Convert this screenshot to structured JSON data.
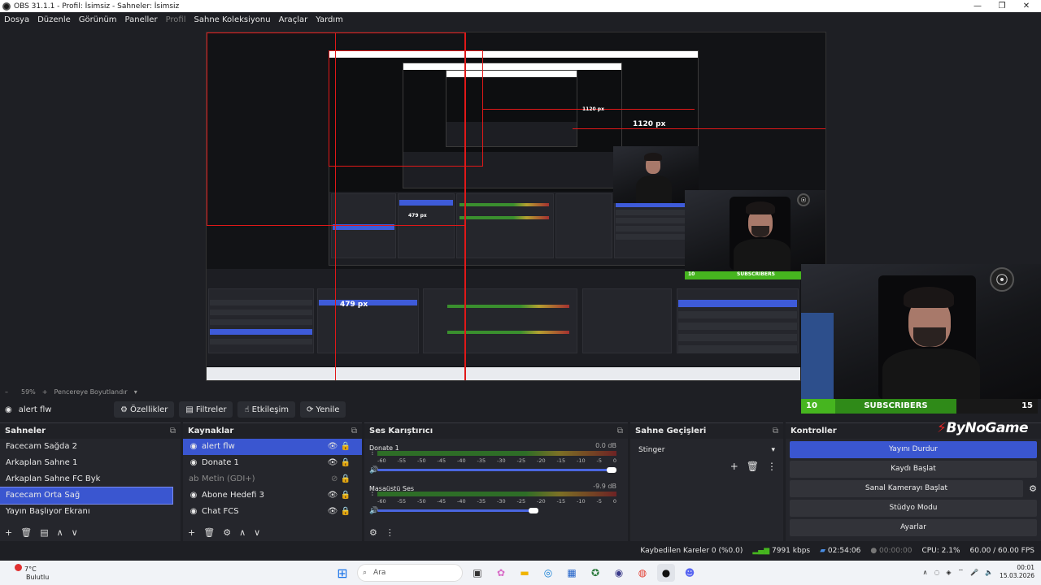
{
  "window": {
    "title": "OBS 31.1.1 - Profil: İsimsiz - Sahneler: İsimsiz",
    "controls": [
      "—",
      "❐",
      "✕"
    ]
  },
  "menu": [
    "Dosya",
    "Düzenle",
    "Görünüm",
    "Paneller",
    "Profil",
    "Sahne Koleksiyonu",
    "Araçlar",
    "Yardım"
  ],
  "preview": {
    "zoom": "59%",
    "zoom_label": "Pencereye Boyutlandır",
    "width_label": "1120 px",
    "height_label": "479 px",
    "nested_width_label": "1120 px",
    "nested_height_label": "479 px"
  },
  "subscribers": {
    "left": "10",
    "label": "SUBSCRIBERS",
    "right": "15"
  },
  "source_toolbar": {
    "selected_source": "alert flw",
    "properties": "Özellikler",
    "filters": "Filtreler",
    "interact": "Etkileşim",
    "refresh": "Yenile"
  },
  "scenes": {
    "title": "Sahneler",
    "items": [
      "Facecam Sağda 2",
      "Arkaplan Sahne 1",
      "Arkaplan Sahne FC Byk",
      "Facecam Orta Sağ",
      "Yayın Başlıyor Ekranı"
    ],
    "selected_index": 3
  },
  "sources": {
    "title": "Kaynaklar",
    "items": [
      {
        "name": "alert flw",
        "icon": "globe-icon"
      },
      {
        "name": "Donate 1",
        "icon": "globe-icon"
      },
      {
        "name": "Metin (GDI+)",
        "icon": "text-icon"
      },
      {
        "name": "Abone Hedefi 3",
        "icon": "globe-icon"
      },
      {
        "name": "Chat FCS",
        "icon": "globe-icon"
      }
    ]
  },
  "mixer": {
    "title": "Ses Karıştırıcı",
    "channels": [
      {
        "name": "Donate 1",
        "db": "0.0 dB",
        "volume": 1.0
      },
      {
        "name": "Masaüstü Ses",
        "db": "-9.9 dB",
        "volume": 0.65
      }
    ],
    "ticks": [
      "-60",
      "-55",
      "-50",
      "-45",
      "-40",
      "-35",
      "-30",
      "-25",
      "-20",
      "-15",
      "-10",
      "-5",
      "0"
    ]
  },
  "transitions": {
    "title": "Sahne Geçişleri",
    "selected": "Stinger"
  },
  "controls": {
    "title": "Kontroller",
    "buttons": [
      "Yayını Durdur",
      "Kaydı Başlat",
      "Sanal Kamerayı Başlat",
      "Stüdyo Modu",
      "Ayarlar"
    ]
  },
  "logo": {
    "text": "ByNoGame"
  },
  "status": {
    "dropped": "Kaybedilen Kareler 0 (%0.0)",
    "bitrate": "7991 kbps",
    "stream_time": "02:54:06",
    "record_time": "00:00:00",
    "cpu": "CPU: 2.1%",
    "fps": "60.00 / 60.00 FPS"
  },
  "taskbar": {
    "temp": "7°C",
    "weather": "Bulutlu",
    "search": "Ara",
    "time": "00:01",
    "date": "15.03.2026"
  },
  "colors": {
    "accent": "#3a56d0",
    "record_red": "#e01818",
    "subs_green": "#46b51f"
  }
}
